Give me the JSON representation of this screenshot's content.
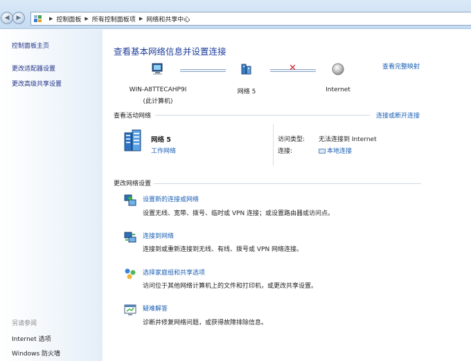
{
  "breadcrumb": [
    "控制面板",
    "所有控制面板项",
    "网络和共享中心"
  ],
  "sidebar": {
    "links": [
      "控制面板主页",
      "更改适配器设置",
      "更改高级共享设置"
    ],
    "see_also_caption": "另请参阅",
    "see_also": [
      "Internet 选项",
      "Windows 防火墙"
    ]
  },
  "main": {
    "heading": "查看基本网络信息并设置连接",
    "full_map_link": "查看完整映射",
    "map": {
      "computer_name": "WIN-A8TTECAHP9I",
      "computer_note": "(此计算机)",
      "network_label": "网络  5",
      "internet_label": "Internet",
      "status_icon": "red-x-icon"
    },
    "active": {
      "title": "查看活动网络",
      "connect_link": "连接或断开连接",
      "network_name": "网络  5",
      "network_category": "工作网络",
      "access_type_label": "访问类型:",
      "access_type_value": "无法连接到 Internet",
      "connections_label": "连接:",
      "connections_value": "本地连接"
    },
    "change": {
      "title": "更改网络设置",
      "tasks": [
        {
          "title": "设置新的连接或网络",
          "desc": "设置无线、宽带、拨号、临时或 VPN 连接；或设置路由器或访问点。",
          "icon": "new-connection-icon"
        },
        {
          "title": "连接到网络",
          "desc": "连接到或重新连接到无线、有线、拨号或 VPN 网络连接。",
          "icon": "connect-network-icon"
        },
        {
          "title": "选择家庭组和共享选项",
          "desc": "访问位于其他网络计算机上的文件和打印机，或更改共享设置。",
          "icon": "homegroup-icon"
        },
        {
          "title": "疑难解答",
          "desc": "诊断并修复网络问题，或获得故障排除信息。",
          "icon": "troubleshoot-icon"
        }
      ]
    }
  }
}
